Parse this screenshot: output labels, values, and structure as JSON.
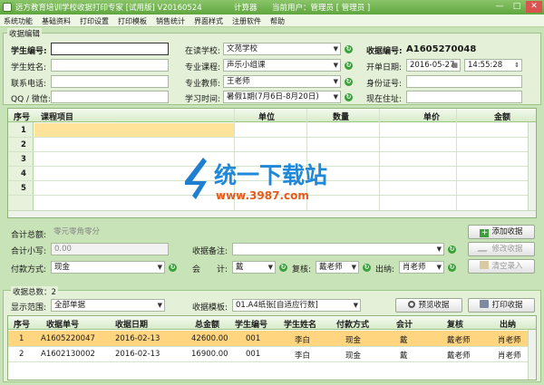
{
  "titlebar": {
    "title": "远方教育培训学校收据打印专家 [试用版]  V20160524",
    "calc": "计算器",
    "current_user": "当前用户：管理员 [ 管理员 ]",
    "min": "—",
    "max": "□",
    "close": "✕"
  },
  "menu": [
    "系统功能",
    "基础资料",
    "打印设置",
    "打印模板",
    "销售统计",
    "界面样式",
    "注册软件",
    "帮助"
  ],
  "receipt": {
    "legend": "收据编辑",
    "student_id_label": "学生编号:",
    "student_id": "",
    "student_name_label": "学生姓名:",
    "student_name": "",
    "phone_label": "联系电话:",
    "phone": "",
    "qq_label": "QQ / 微信:",
    "qq": "",
    "school_label": "在读学校:",
    "school": "文苑学校",
    "course_label": "专业课程:",
    "course": "声乐小组课",
    "teacher_label": "专业教师:",
    "teacher": "王老师",
    "period_label": "学习时间:",
    "period": "暑假1期(7月6日-8月20日)",
    "receipt_no_label": "收据编号:",
    "receipt_no": "A1605270048",
    "date_label": "开单日期:",
    "date": "2016-05-27",
    "time": "14:55:28",
    "id_card_label": "身份证号:",
    "id_card": "",
    "address_label": "现在住址:",
    "address": ""
  },
  "items_table": {
    "headers": [
      "序号",
      "课程项目",
      "单位",
      "数量",
      "单价",
      "金额"
    ],
    "rows": [
      "1",
      "2",
      "3",
      "4",
      "5"
    ]
  },
  "totals": {
    "total_label": "合计总额:",
    "total_text": "零元零角零分",
    "small_label": "合计小写:",
    "small_value": "0.00",
    "payment_label": "付款方式:",
    "payment": "现金",
    "remark_label": "收据备注:",
    "remark": "",
    "accountant_label": "会　　计:",
    "accountant": "戴",
    "reviewer_label": "复核:",
    "reviewer": "戴老师",
    "cashier_label": "出纳:",
    "cashier": "肖老师",
    "add_btn": "添加收据",
    "edit_btn": "修改收据",
    "clear_btn": "清空录入"
  },
  "list": {
    "count_label": "收据总数：2",
    "range_label": "显示范围:",
    "range": "全部单据",
    "template_label": "收据模板:",
    "template": "01.A4纸张[自适应行数]",
    "preview_btn": "预览收据",
    "print_btn": "打印收据",
    "headers": [
      "序号",
      "收据单号",
      "收据日期",
      "总金额",
      "学生编号",
      "学生姓名",
      "付款方式",
      "会计",
      "复核",
      "出纳"
    ],
    "rows": [
      [
        "1",
        "A1605220047",
        "2016-02-13",
        "42600.00",
        "001",
        "李白",
        "现金",
        "戴",
        "戴老师",
        "肖老师"
      ],
      [
        "2",
        "A1602130002",
        "2016-02-13",
        "16900.00",
        "001",
        "李白",
        "现金",
        "戴",
        "戴老师",
        "肖老师"
      ]
    ]
  },
  "watermark": {
    "name": "统一下载站",
    "url": "www.3987.com"
  },
  "colors": {
    "accent": "#5fa63e",
    "selected_row": "#ffd580",
    "panel": "#e4f1d8"
  }
}
